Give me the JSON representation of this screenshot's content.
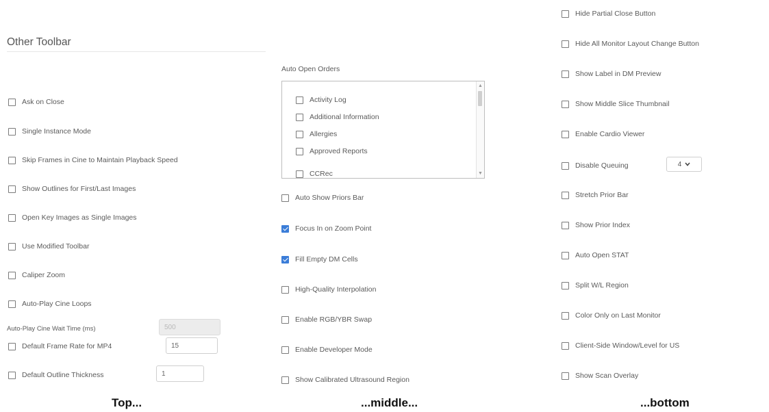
{
  "left": {
    "heading": "Other Toolbar",
    "options": [
      {
        "label": "Ask on Close",
        "checked": false
      },
      {
        "label": "Single Instance Mode",
        "checked": false
      },
      {
        "label": "Skip Frames in Cine to Maintain Playback Speed",
        "checked": false
      },
      {
        "label": "Show Outlines for First/Last Images",
        "checked": false
      },
      {
        "label": "Open Key Images as Single Images",
        "checked": false
      },
      {
        "label": "Use Modified Toolbar",
        "checked": false
      },
      {
        "label": "Caliper Zoom",
        "checked": false
      },
      {
        "label": "Auto-Play Cine Loops",
        "checked": false
      }
    ],
    "cine_wait_label": "Auto-Play Cine Wait Time (ms)",
    "cine_wait_value": "500",
    "frame_rate_label": "Default Frame Rate for MP4",
    "frame_rate_value": "15",
    "outline_label": "Default Outline Thickness",
    "outline_value": "1"
  },
  "middle": {
    "auto_open_label": "Auto Open Orders",
    "orders": [
      "Activity Log",
      "Additional Information",
      "Allergies",
      "Approved Reports",
      "CCRec"
    ],
    "options": [
      {
        "label": "Auto Show Priors Bar",
        "checked": false
      },
      {
        "label": "Focus In on Zoom Point",
        "checked": true
      },
      {
        "label": "Fill Empty DM Cells",
        "checked": true
      },
      {
        "label": "High-Quality Interpolation",
        "checked": false
      },
      {
        "label": "Enable RGB/YBR Swap",
        "checked": false
      },
      {
        "label": "Enable Developer Mode",
        "checked": false
      },
      {
        "label": "Show Calibrated Ultrasound Region",
        "checked": false
      }
    ]
  },
  "right": {
    "options_top": [
      {
        "label": "Hide Partial Close Button",
        "checked": false
      },
      {
        "label": "Hide All Monitor Layout Change Button",
        "checked": false
      },
      {
        "label": "Show Label in DM Preview",
        "checked": false
      },
      {
        "label": "Show Middle Slice Thumbnail",
        "checked": false
      },
      {
        "label": "Enable Cardio Viewer",
        "checked": false
      }
    ],
    "queuing_label": "Disable Queuing",
    "queuing_value": "4",
    "options_bottom": [
      {
        "label": "Stretch Prior Bar",
        "checked": false
      },
      {
        "label": "Show Prior Index",
        "checked": false
      },
      {
        "label": "Auto Open STAT",
        "checked": false
      },
      {
        "label": "Split W/L Region",
        "checked": false
      },
      {
        "label": "Color Only on Last Monitor",
        "checked": false
      },
      {
        "label": "Client-Side Window/Level for US",
        "checked": false
      },
      {
        "label": "Show Scan Overlay",
        "checked": false
      }
    ]
  },
  "captions": [
    "Top...",
    "...middle...",
    "...bottom"
  ],
  "icons": {
    "checkbox": "checkbox-icon",
    "chevron": "chevron-down-icon"
  },
  "colors": {
    "checked": "#3b7dd8"
  }
}
